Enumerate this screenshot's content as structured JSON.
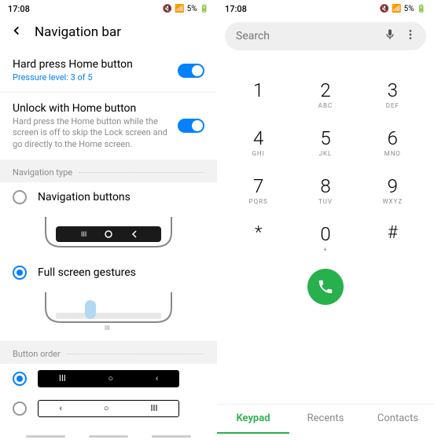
{
  "status": {
    "time": "17:08",
    "battery": "5%"
  },
  "left": {
    "title": "Navigation bar",
    "settings": [
      {
        "title": "Hard press Home button",
        "sub": "Pressure level: 3 of 5"
      },
      {
        "title": "Unlock with Home button",
        "desc": "Hard press the Home button while the screen is off to skip the Lock screen and go directly to the Home screen."
      }
    ],
    "navType": {
      "label": "Navigation type",
      "options": [
        "Navigation buttons",
        "Full screen gestures"
      ]
    },
    "buttonOrder": {
      "label": "Button order"
    }
  },
  "right": {
    "search": {
      "placeholder": "Search"
    },
    "keys": [
      [
        {
          "n": "1",
          "l": ""
        },
        {
          "n": "2",
          "l": "ABC"
        },
        {
          "n": "3",
          "l": "DEF"
        }
      ],
      [
        {
          "n": "4",
          "l": "GHI"
        },
        {
          "n": "5",
          "l": "JKL"
        },
        {
          "n": "6",
          "l": "MNO"
        }
      ],
      [
        {
          "n": "7",
          "l": "PQRS"
        },
        {
          "n": "8",
          "l": "TUV"
        },
        {
          "n": "9",
          "l": "WXYZ"
        }
      ],
      [
        {
          "n": "*",
          "l": ""
        },
        {
          "n": "0",
          "l": "+"
        },
        {
          "n": "#",
          "l": ""
        }
      ]
    ],
    "tabs": [
      "Keypad",
      "Recents",
      "Contacts"
    ]
  }
}
